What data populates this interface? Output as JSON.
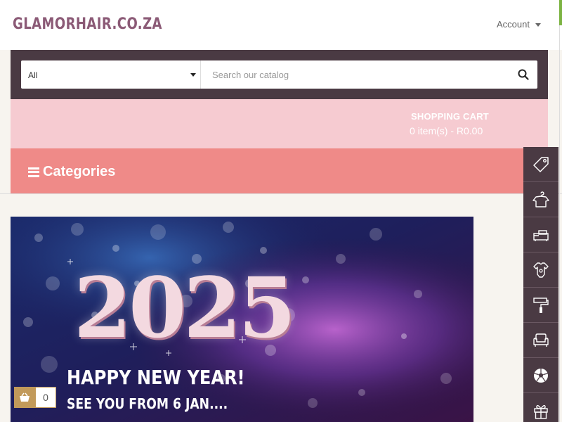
{
  "header": {
    "logo": "GLAMORHAIR.CO.ZA",
    "account_label": "Account"
  },
  "search": {
    "category_selected": "All",
    "placeholder": "Search our catalog"
  },
  "cart": {
    "title": "SHOPPING CART",
    "summary": "0 item(s) - R0.00"
  },
  "categories": {
    "label": "Categories"
  },
  "banner": {
    "year": "2025",
    "line1": "HAPPY NEW YEAR!",
    "line2": "SEE YOU FROM 6 JAN...."
  },
  "mini_cart": {
    "count": "0"
  },
  "side_nav": {
    "icons": [
      "tag-icon",
      "shirt-hanger-icon",
      "furniture-icon",
      "baby-onesie-icon",
      "paint-roller-icon",
      "armchair-icon",
      "soccer-ball-icon",
      "gift-icon"
    ]
  },
  "colors": {
    "brand_dark": "#4a3a43",
    "cart_band": "#f6cbd1",
    "categories_band": "#ef8a88",
    "logo": "#8b5a76",
    "accent_gold": "#c29a5a"
  }
}
